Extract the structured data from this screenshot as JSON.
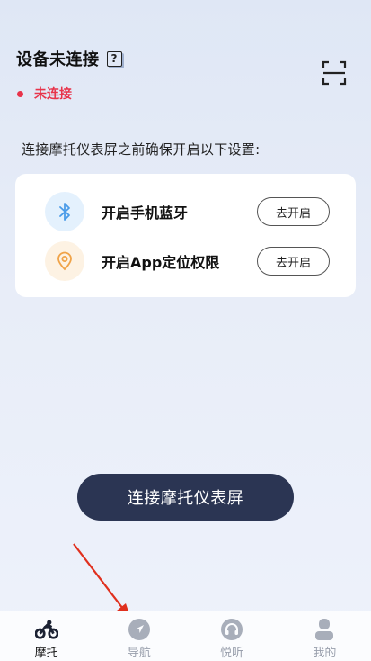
{
  "header": {
    "title": "设备未连接",
    "help_icon": "help-icon",
    "status_text": "未连接",
    "status_color": "#e8334a"
  },
  "scan_icon": "scan-icon",
  "instruction": "连接摩托仪表屏之前确保开启以下设置:",
  "settings": [
    {
      "label": "开启手机蓝牙",
      "button": "去开启",
      "icon": "bluetooth-icon",
      "icon_color": "#4a9be8"
    },
    {
      "label": "开启App定位权限",
      "button": "去开启",
      "icon": "location-icon",
      "icon_color": "#f0a348"
    }
  ],
  "connect_button": "连接摩托仪表屏",
  "tabs": [
    {
      "label": "摩托",
      "icon": "motorbike-icon",
      "active": true
    },
    {
      "label": "导航",
      "icon": "navigation-icon",
      "active": false
    },
    {
      "label": "悦听",
      "icon": "headphones-icon",
      "active": false
    },
    {
      "label": "我的",
      "icon": "profile-icon",
      "active": false
    }
  ],
  "colors": {
    "primary_dark": "#2b3553",
    "annotation_arrow": "#e0301e"
  }
}
